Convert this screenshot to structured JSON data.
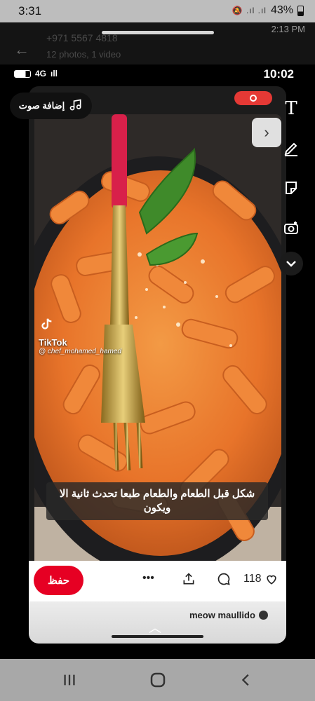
{
  "status_bar": {
    "time": "3:31",
    "battery": "43%",
    "icons": "🔕 .ıl .ıl"
  },
  "background_app": {
    "time": "2:13 PM",
    "line1": "+971 5567 4818",
    "line2": "12 photos, 1 video"
  },
  "inner_status_bar": {
    "network": "4G",
    "time": "10:02"
  },
  "story": {
    "audio_label": "إضافة صوت",
    "tiktok_name": "TikTok",
    "tiktok_user": "@ chef_mohamed_hamed",
    "caption": "شكل قبل الطعام والطعام طبعا تحدث ثانية الا ويكون",
    "tools": {
      "text": "T"
    }
  },
  "action_bar": {
    "save_label": "حفظ",
    "likes_count": "118"
  },
  "bottom_sheet": {
    "username": "meow maullido"
  },
  "colors": {
    "save_red": "#e60023",
    "record_red": "#e53935",
    "pasta_orange": "#e8742a"
  }
}
